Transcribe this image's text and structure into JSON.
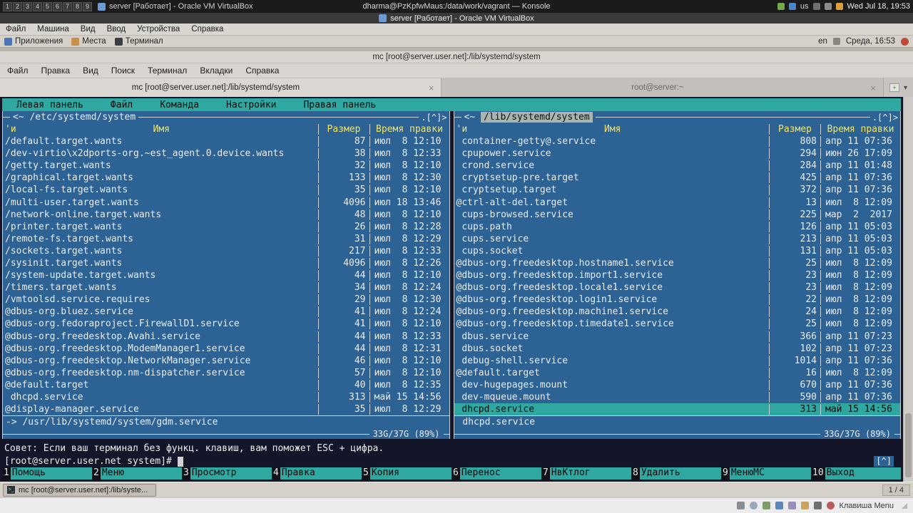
{
  "icons": {
    "close": "×",
    "chevron_down": "▾",
    "new_tab_plus": "+",
    "terminal_glyph": ">_"
  },
  "colors": {
    "mc_panel_blue": "#2d6295",
    "mc_cyan": "#2fa8a2",
    "header_yellow": "#f1e567",
    "terminal_bg": "#15152a",
    "selection_bg": "#2fa8a2"
  },
  "host_bar": {
    "workspaces": [
      "1",
      "2",
      "3",
      "4",
      "5",
      "6",
      "7",
      "8",
      "9"
    ],
    "active_window": "server [Работает] - Oracle VM VirtualBox",
    "center_title": "dharma@PzKpfwMaus:/data/work/vagrant — Konsole",
    "keyboard_layout": "us",
    "clock": "Wed Jul 18, 19:53"
  },
  "vbox": {
    "title": "server [Работает] - Oracle VM VirtualBox",
    "menu": [
      "Файл",
      "Машина",
      "Вид",
      "Ввод",
      "Устройства",
      "Справка"
    ],
    "hostkey": "Клавиша Menu"
  },
  "guest_panel": {
    "menus": [
      "Приложения",
      "Места",
      "Терминал"
    ],
    "layout": "en",
    "clock": "Среда, 16:53"
  },
  "terminal": {
    "title": "mc [root@server.user.net]:/lib/systemd/system",
    "menu": [
      "Файл",
      "Правка",
      "Вид",
      "Поиск",
      "Терминал",
      "Вкладки",
      "Справка"
    ],
    "tabs": [
      {
        "label": "mc [root@server.user.net]:/lib/systemd/system",
        "active": true
      },
      {
        "label": "root@server:~",
        "active": false
      }
    ]
  },
  "mc": {
    "menubar": [
      "Левая панель",
      "Файл",
      "Команда",
      "Настройки",
      "Правая панель"
    ],
    "hint": "Совет: Если ваш терминал без функц. клавиш, вам поможет ESC + цифра.",
    "prompt": "[root@server.user.net system]#",
    "scroll_badge": "[^]",
    "fn_keys": [
      {
        "num": "1",
        "label": "Помощь"
      },
      {
        "num": "2",
        "label": "Меню"
      },
      {
        "num": "3",
        "label": "Просмотр"
      },
      {
        "num": "4",
        "label": "Правка"
      },
      {
        "num": "5",
        "label": "Копия"
      },
      {
        "num": "6",
        "label": "Перенос"
      },
      {
        "num": "7",
        "label": "НвКтлог"
      },
      {
        "num": "8",
        "label": "Удалить"
      },
      {
        "num": "9",
        "label": "МенюМС"
      },
      {
        "num": "10",
        "label": "Выход"
      }
    ],
    "panels": {
      "left": {
        "title_prefix": "<~ ",
        "title_path": "/etc/systemd/system",
        "corner": ".[^]>",
        "sort_marker": "'и",
        "headers": {
          "name": "Имя",
          "size": "Размер",
          "mtime": "Время правки"
        },
        "mini_status": "-> /usr/lib/systemd/system/gdm.service",
        "stats": "33G/37G (89%)",
        "rows": [
          {
            "name": "/default.target.wants",
            "size": "87",
            "date": "июл  8 12:10"
          },
          {
            "name": "/dev-virtio\\x2dports-org.~est_agent.0.device.wants",
            "size": "38",
            "date": "июл  8 12:33"
          },
          {
            "name": "/getty.target.wants",
            "size": "32",
            "date": "июл  8 12:10"
          },
          {
            "name": "/graphical.target.wants",
            "size": "133",
            "date": "июл  8 12:30"
          },
          {
            "name": "/local-fs.target.wants",
            "size": "35",
            "date": "июл  8 12:10"
          },
          {
            "name": "/multi-user.target.wants",
            "size": "4096",
            "date": "июл 18 13:46"
          },
          {
            "name": "/network-online.target.wants",
            "size": "48",
            "date": "июл  8 12:10"
          },
          {
            "name": "/printer.target.wants",
            "size": "26",
            "date": "июл  8 12:28"
          },
          {
            "name": "/remote-fs.target.wants",
            "size": "31",
            "date": "июл  8 12:29"
          },
          {
            "name": "/sockets.target.wants",
            "size": "217",
            "date": "июл  8 12:33"
          },
          {
            "name": "/sysinit.target.wants",
            "size": "4096",
            "date": "июл  8 12:26"
          },
          {
            "name": "/system-update.target.wants",
            "size": "44",
            "date": "июл  8 12:10"
          },
          {
            "name": "/timers.target.wants",
            "size": "34",
            "date": "июл  8 12:24"
          },
          {
            "name": "/vmtoolsd.service.requires",
            "size": "29",
            "date": "июл  8 12:30"
          },
          {
            "name": "@dbus-org.bluez.service",
            "size": "41",
            "date": "июл  8 12:24"
          },
          {
            "name": "@dbus-org.fedoraproject.FirewallD1.service",
            "size": "41",
            "date": "июл  8 12:10"
          },
          {
            "name": "@dbus-org.freedesktop.Avahi.service",
            "size": "44",
            "date": "июл  8 12:33"
          },
          {
            "name": "@dbus-org.freedesktop.ModemManager1.service",
            "size": "44",
            "date": "июл  8 12:31"
          },
          {
            "name": "@dbus-org.freedesktop.NetworkManager.service",
            "size": "46",
            "date": "июл  8 12:10"
          },
          {
            "name": "@dbus-org.freedesktop.nm-dispatcher.service",
            "size": "57",
            "date": "июл  8 12:10"
          },
          {
            "name": "@default.target",
            "size": "40",
            "date": "июл  8 12:35"
          },
          {
            "name": " dhcpd.service",
            "size": "313",
            "date": "май 15 14:56"
          },
          {
            "name": "@display-manager.service",
            "size": "35",
            "date": "июл  8 12:29"
          }
        ]
      },
      "right": {
        "title_prefix": "<~ ",
        "title_path": "/lib/systemd/system",
        "corner": ".[^]>",
        "sort_marker": "'и",
        "headers": {
          "name": "Имя",
          "size": "Размер",
          "mtime": "Время правки"
        },
        "mini_status": " dhcpd.service",
        "stats": "33G/37G (89%)",
        "rows": [
          {
            "name": " container-getty@.service",
            "size": "808",
            "date": "апр 11 07:36"
          },
          {
            "name": " cpupower.service",
            "size": "294",
            "date": "июн 26 17:09"
          },
          {
            "name": " crond.service",
            "size": "284",
            "date": "апр 11 01:48"
          },
          {
            "name": " cryptsetup-pre.target",
            "size": "425",
            "date": "апр 11 07:36"
          },
          {
            "name": " cryptsetup.target",
            "size": "372",
            "date": "апр 11 07:36"
          },
          {
            "name": "@ctrl-alt-del.target",
            "size": "13",
            "date": "июл  8 12:09"
          },
          {
            "name": " cups-browsed.service",
            "size": "225",
            "date": "мар  2  2017"
          },
          {
            "name": " cups.path",
            "size": "126",
            "date": "апр 11 05:03"
          },
          {
            "name": " cups.service",
            "size": "213",
            "date": "апр 11 05:03"
          },
          {
            "name": " cups.socket",
            "size": "131",
            "date": "апр 11 05:03"
          },
          {
            "name": "@dbus-org.freedesktop.hostname1.service",
            "size": "25",
            "date": "июл  8 12:09"
          },
          {
            "name": "@dbus-org.freedesktop.import1.service",
            "size": "23",
            "date": "июл  8 12:09"
          },
          {
            "name": "@dbus-org.freedesktop.locale1.service",
            "size": "23",
            "date": "июл  8 12:09"
          },
          {
            "name": "@dbus-org.freedesktop.login1.service",
            "size": "22",
            "date": "июл  8 12:09"
          },
          {
            "name": "@dbus-org.freedesktop.machine1.service",
            "size": "24",
            "date": "июл  8 12:09"
          },
          {
            "name": "@dbus-org.freedesktop.timedate1.service",
            "size": "25",
            "date": "июл  8 12:09"
          },
          {
            "name": " dbus.service",
            "size": "366",
            "date": "апр 11 07:23"
          },
          {
            "name": " dbus.socket",
            "size": "102",
            "date": "апр 11 07:23"
          },
          {
            "name": " debug-shell.service",
            "size": "1014",
            "date": "апр 11 07:36"
          },
          {
            "name": "@default.target",
            "size": "16",
            "date": "июл  8 12:09"
          },
          {
            "name": " dev-hugepages.mount",
            "size": "670",
            "date": "апр 11 07:36"
          },
          {
            "name": " dev-mqueue.mount",
            "size": "590",
            "date": "апр 11 07:36"
          },
          {
            "name": " dhcpd.service",
            "size": "313",
            "date": "май 15 14:56",
            "selected": true
          }
        ]
      }
    }
  },
  "taskbar": {
    "task": "mc [root@server.user.net]:/lib/syste...",
    "pager": "1 / 4"
  }
}
